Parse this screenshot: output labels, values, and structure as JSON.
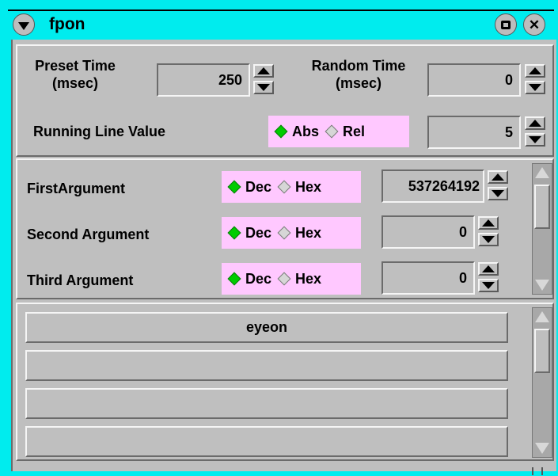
{
  "window": {
    "title": "fpon"
  },
  "timing": {
    "preset_label_line1": "Preset Time",
    "preset_label_line2": "(msec)",
    "preset_value": "250",
    "random_label_line1": "Random Time",
    "random_label_line2": "(msec)",
    "random_value": "0",
    "running_label": "Running Line Value",
    "running_opt1": "Abs",
    "running_opt2": "Rel",
    "running_selected": "Abs",
    "running_value": "5"
  },
  "arguments": [
    {
      "label": "FirstArgument",
      "opt1": "Dec",
      "opt2": "Hex",
      "selected": "Dec",
      "value": "537264192"
    },
    {
      "label": "Second Argument",
      "opt1": "Dec",
      "opt2": "Hex",
      "selected": "Dec",
      "value": "0"
    },
    {
      "label": "Third Argument",
      "opt1": "Dec",
      "opt2": "Hex",
      "selected": "Dec",
      "value": "0"
    }
  ],
  "list": {
    "items": [
      "eyeon",
      "",
      "",
      ""
    ]
  },
  "colors": {
    "titlebar": "#00ecee",
    "panel": "#bfbfbf",
    "radio_bg": "#ffc8ff",
    "radio_on": "#00cc00"
  },
  "icons": [
    "menu-down-icon",
    "maximize-icon",
    "close-icon",
    "spin-up-icon",
    "spin-down-icon",
    "scroll-up-icon",
    "scroll-down-icon"
  ]
}
